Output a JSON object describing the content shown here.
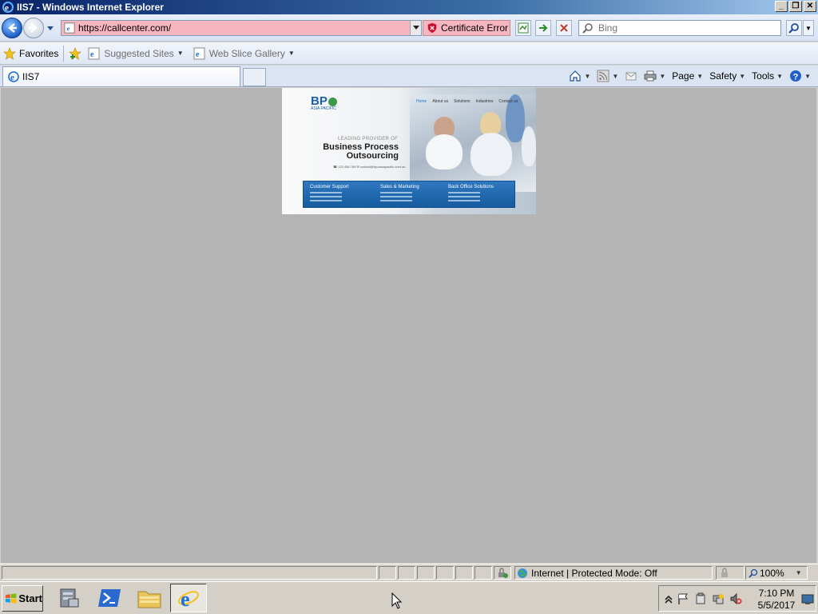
{
  "window": {
    "title": "IIS7 - Windows Internet Explorer",
    "minimize": "_",
    "restore": "❐",
    "close": "✕"
  },
  "address": {
    "url": "https://callcenter.com/",
    "cert_error": "Certificate Error",
    "bar_color": "#f7b5c0"
  },
  "search": {
    "placeholder": "Bing"
  },
  "favorites": {
    "label": "Favorites",
    "items": [
      "Suggested Sites",
      "Web Slice Gallery"
    ]
  },
  "tab": {
    "title": "IIS7"
  },
  "commands": {
    "page": "Page",
    "safety": "Safety",
    "tools": "Tools"
  },
  "site": {
    "logo": "BP",
    "logo_sub": "ASIA PACIFIC",
    "nav": [
      "Home",
      "About us",
      "Solutions",
      "Industries",
      "Contact us"
    ],
    "tagline": "LEADING PROVIDER OF",
    "headline_1": "Business Process",
    "headline_2": "Outsourcing",
    "contact": "☎ 123 456 789     ✉ contact@bpoasiapacific.com.au",
    "columns": [
      "Customer Support",
      "Sales & Marketing",
      "Back Office Solutions"
    ]
  },
  "status": {
    "zone": "Internet | Protected Mode: Off",
    "zoom": "100%"
  },
  "taskbar": {
    "start": "Start",
    "time": "7:10 PM",
    "date": "5/5/2017"
  }
}
